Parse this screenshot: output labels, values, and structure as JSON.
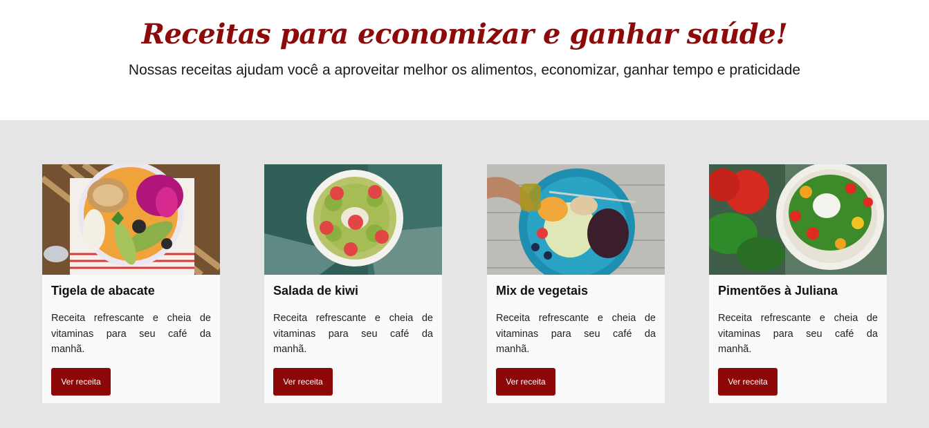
{
  "hero": {
    "title": "Receitas para economizar e ganhar saúde!",
    "subtitle": "Nossas receitas ajudam você a aproveitar melhor os alimentos, economizar, ganhar tempo e praticidade"
  },
  "theme": {
    "accent": "#8c0707",
    "section_bg": "#e5e5e5",
    "card_bg": "#fafafa"
  },
  "cards": [
    {
      "title": "Tigela de abacate",
      "description": "Receita refrescante e cheia de vitaminas para seu café da manhã.",
      "button_label": "Ver receita",
      "image_icon": "avocado-bowl-photo"
    },
    {
      "title": "Salada de kiwi",
      "description": "Receita refrescante e cheia de vitaminas para seu café da manhã.",
      "button_label": "Ver receita",
      "image_icon": "kiwi-bowl-photo"
    },
    {
      "title": "Mix de vegetais",
      "description": "Receita refrescante e cheia de vitaminas para seu café da manhã.",
      "button_label": "Ver receita",
      "image_icon": "vegetable-plate-photo"
    },
    {
      "title": "Pimentões à Juliana",
      "description": "Receita refrescante e cheia de vitaminas para seu café da manhã.",
      "button_label": "Ver receita",
      "image_icon": "pepper-salad-photo"
    }
  ]
}
